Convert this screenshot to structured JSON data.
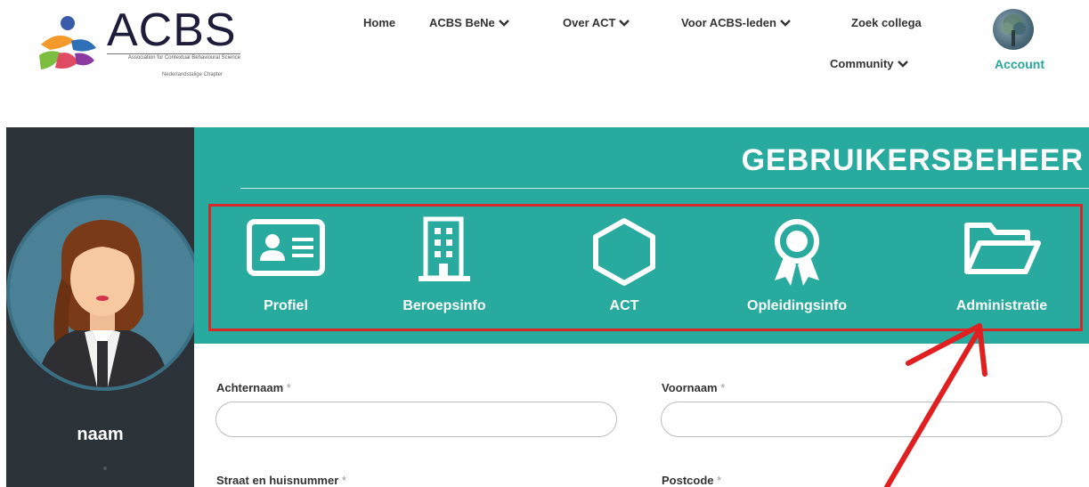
{
  "header": {
    "logo": {
      "title": "ACBS",
      "subtitle": "Association for Contextual Behavioural Science",
      "chapter": "Nederlandstalige Chapter"
    },
    "nav": [
      {
        "label": "Home"
      },
      {
        "label": "ACBS BeNe"
      },
      {
        "label": "Over ACT"
      },
      {
        "label": "Voor ACBS-leden"
      },
      {
        "label": "Zoek collega"
      },
      {
        "label": "Community"
      }
    ],
    "account_label": "Account"
  },
  "sidebar": {
    "name": "naam"
  },
  "panel": {
    "title": "GEBRUIKERSBEHEER",
    "tabs": [
      {
        "label": "Profiel",
        "icon": "id-card-icon"
      },
      {
        "label": "Beroepsinfo",
        "icon": "building-icon"
      },
      {
        "label": "ACT",
        "icon": "hexagon-icon"
      },
      {
        "label": "Opleidingsinfo",
        "icon": "award-ribbon-icon"
      },
      {
        "label": "Administratie",
        "icon": "folder-open-icon"
      }
    ]
  },
  "form": {
    "lastname_label": "Achternaam",
    "firstname_label": "Voornaam",
    "street_label": "Straat en huisnummer",
    "postcode_label": "Postcode",
    "required_marker": "*"
  },
  "colors": {
    "teal": "#28ab9e",
    "dark": "#2c3338",
    "highlight_red": "#d62a2a",
    "accent_text": "#27a69a"
  }
}
